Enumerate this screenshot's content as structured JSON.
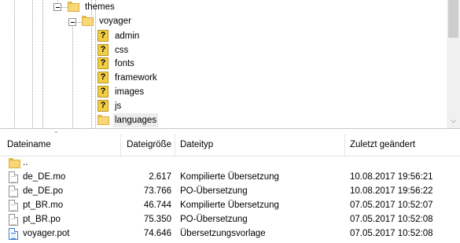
{
  "tree": {
    "nodes": [
      {
        "id": "themes",
        "label": "themes",
        "icon": "folder-icon",
        "expanded": true
      },
      {
        "id": "voyager",
        "label": "voyager",
        "icon": "folder-icon",
        "expanded": true
      },
      {
        "id": "admin",
        "label": "admin",
        "icon": "unknown-folder-icon"
      },
      {
        "id": "css",
        "label": "css",
        "icon": "unknown-folder-icon"
      },
      {
        "id": "fonts",
        "label": "fonts",
        "icon": "unknown-folder-icon"
      },
      {
        "id": "framework",
        "label": "framework",
        "icon": "unknown-folder-icon"
      },
      {
        "id": "images",
        "label": "images",
        "icon": "unknown-folder-icon"
      },
      {
        "id": "js",
        "label": "js",
        "icon": "unknown-folder-icon"
      },
      {
        "id": "languages",
        "label": "languages",
        "icon": "folder-icon",
        "selected": true
      }
    ],
    "unknown_glyph": "?"
  },
  "columns": {
    "name": "Dateiname",
    "size": "Dateigröße",
    "type": "Dateityp",
    "modified": "Zuletzt geändert"
  },
  "files": [
    {
      "name": "..",
      "size": "",
      "type": "",
      "modified": "",
      "icon": "folder-icon"
    },
    {
      "name": "de_DE.mo",
      "size": "2.617",
      "type": "Kompilierte Übersetzung",
      "modified": "10.08.2017 19:56:21",
      "icon": "file-icon"
    },
    {
      "name": "de_DE.po",
      "size": "73.766",
      "type": "PO-Übersetzung",
      "modified": "10.08.2017 19:56:22",
      "icon": "file-icon"
    },
    {
      "name": "pt_BR.mo",
      "size": "46.744",
      "type": "Kompilierte Übersetzung",
      "modified": "07.05.2017 10:52:07",
      "icon": "file-icon"
    },
    {
      "name": "pt_BR.po",
      "size": "75.350",
      "type": "PO-Übersetzung",
      "modified": "07.05.2017 10:52:08",
      "icon": "file-icon"
    },
    {
      "name": "voyager.pot",
      "size": "74.646",
      "type": "Übersetzungsvorlage",
      "modified": "07.05.2017 10:52:08",
      "icon": "template-file-icon"
    }
  ],
  "colors": {
    "folder": "#f8d775",
    "selection": "#ececec",
    "question_icon": "#f3ce42"
  }
}
